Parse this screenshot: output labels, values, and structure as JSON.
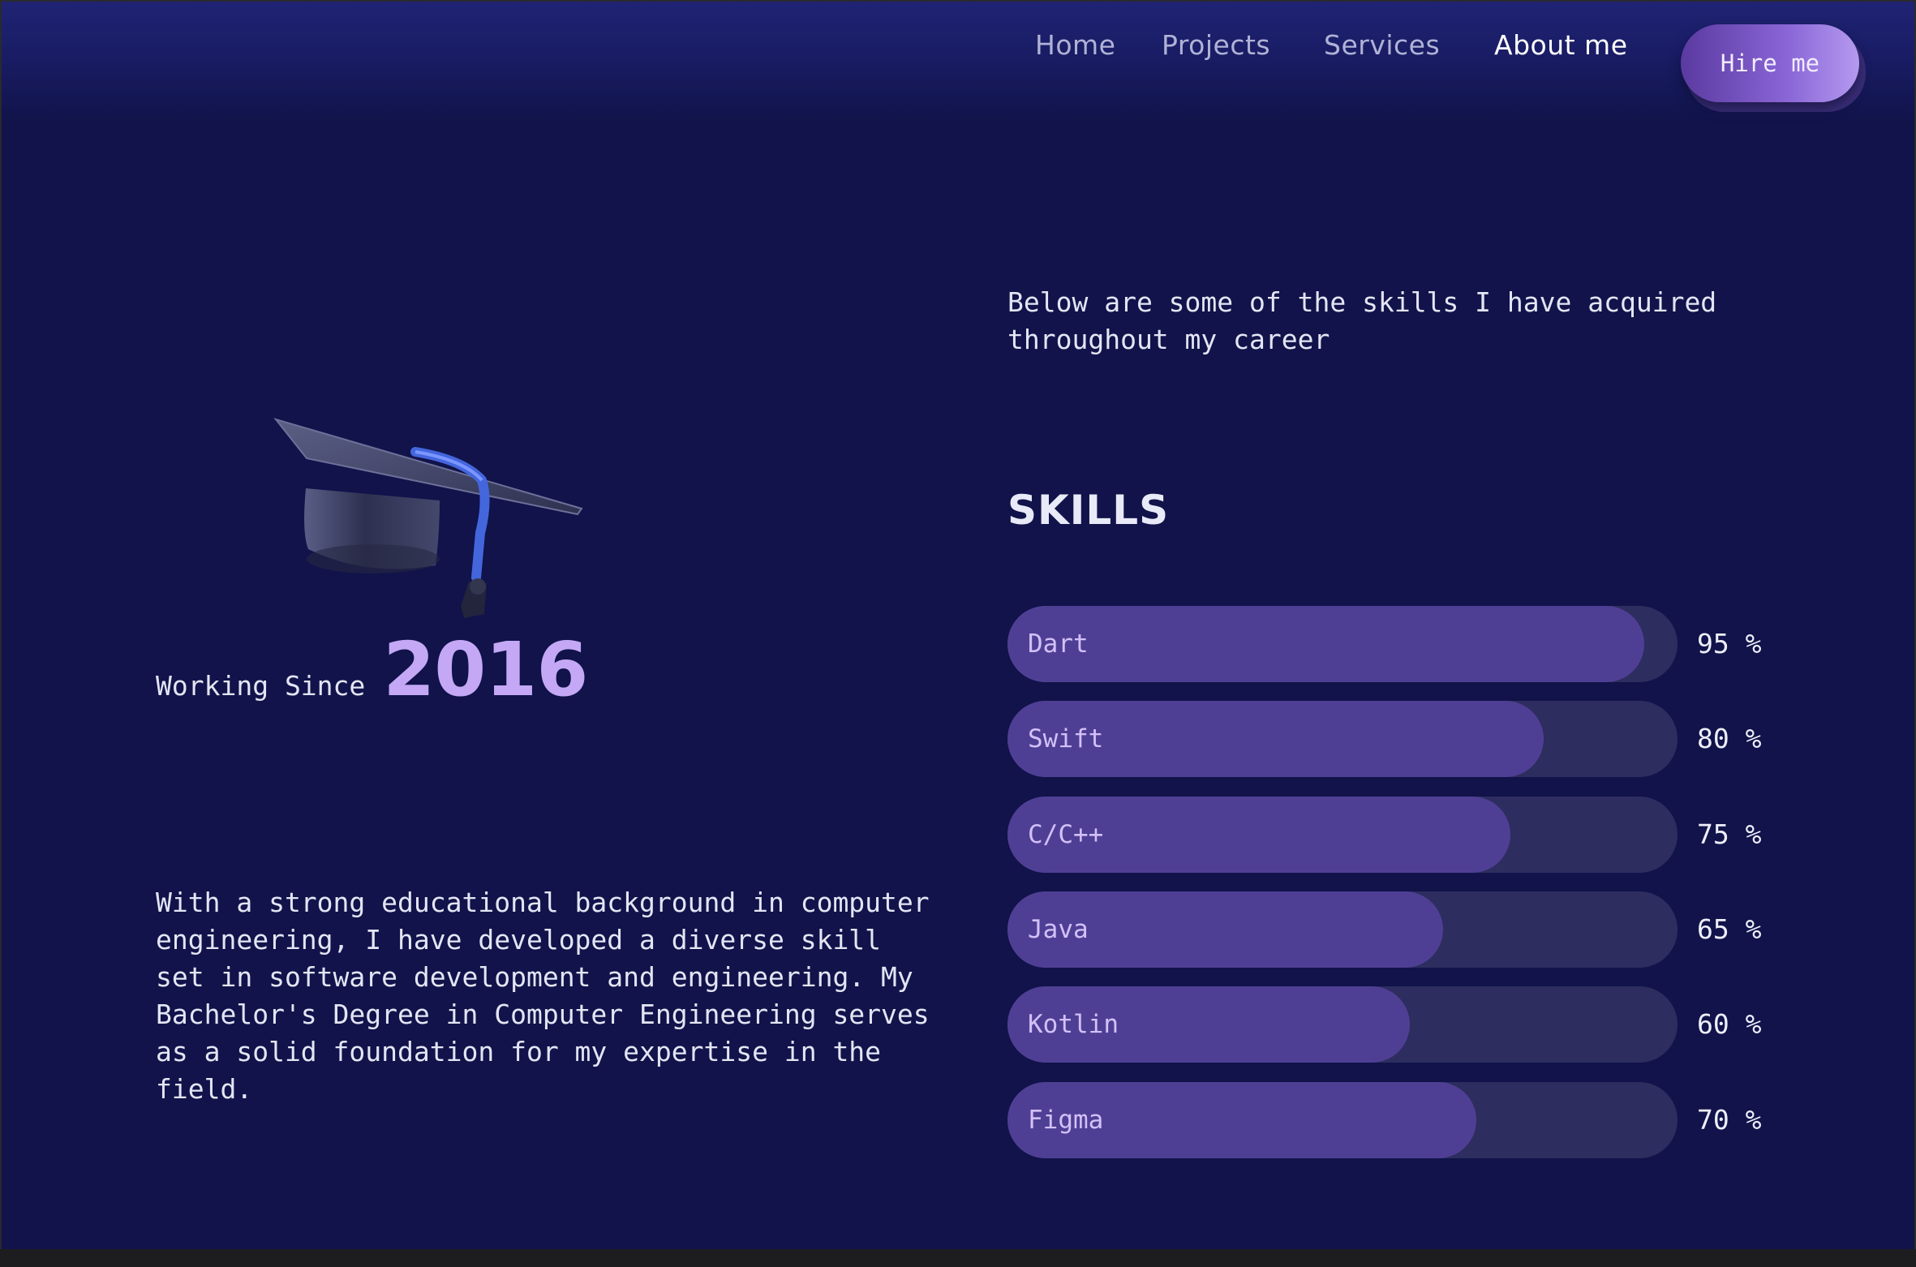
{
  "nav": {
    "links": [
      "Home",
      "Projects",
      "Services",
      "About me"
    ],
    "active": "About me",
    "hire_label": "Hire me"
  },
  "left": {
    "icon": "graduation-cap-icon",
    "working_label": "Working Since",
    "working_year": "2016",
    "bio": "With a strong educational background in computer engineering, I have developed a diverse skill set in software development and engineering. My Bachelor's Degree in Computer Engineering serves as a solid foundation for my expertise in the field."
  },
  "right": {
    "intro": "Below are some of the skills I have acquired throughout my career",
    "skills_title": "SKILLS",
    "skills": [
      {
        "name": "Dart",
        "percent": 95,
        "label": "95 %"
      },
      {
        "name": "Swift",
        "percent": 80,
        "label": "80 %"
      },
      {
        "name": "C/C++",
        "percent": 75,
        "label": "75 %"
      },
      {
        "name": "Java",
        "percent": 65,
        "label": "65 %"
      },
      {
        "name": "Kotlin",
        "percent": 60,
        "label": "60 %"
      },
      {
        "name": "Figma",
        "percent": 70,
        "label": "70 %"
      }
    ]
  },
  "colors": {
    "background": "#11134a",
    "accent": "#c4a8f5",
    "bar_fill": "#4f3f94",
    "bar_track": "#2d2d60"
  }
}
